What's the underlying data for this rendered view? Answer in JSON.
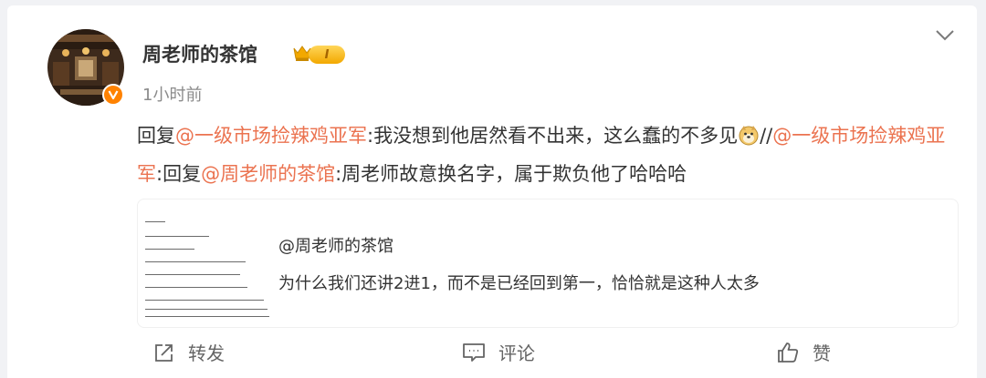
{
  "post": {
    "author": "周老师的茶馆",
    "level_badge": "I",
    "time": "1小时前",
    "content": {
      "reply_prefix_1": "回复",
      "mention_1": "@一级市场捡辣鸡亚军",
      "text_1": ":我没想到他居然看不出来，这么蠢的不多见",
      "separator": "//",
      "mention_2": "@一级市场捡辣鸡亚军",
      "text_2": ":回复",
      "mention_3": "@周老师的茶馆",
      "text_3": ":周老师故意换名字，属于欺负他了哈哈哈"
    },
    "quote": {
      "author": "@周老师的茶馆",
      "text": "为什么我们还讲2进1，而不是已经回到第一，恰恰就是这种人太多"
    }
  },
  "actions": {
    "repost": "转发",
    "comment": "评论",
    "like": "赞"
  },
  "colors": {
    "mention": "#eb7350",
    "verified_badge": "#ff8200",
    "level_badge": "#f2a800"
  },
  "icons": [
    "avatar",
    "verified-icon",
    "crown-icon",
    "chevron-down-icon",
    "doge-emoji-icon",
    "repost-icon",
    "comment-icon",
    "like-icon"
  ]
}
